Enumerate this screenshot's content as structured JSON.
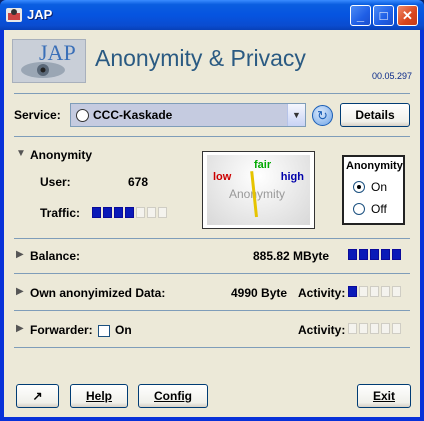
{
  "window": {
    "title": "JAP",
    "minimize": "_",
    "maximize": "□",
    "close": "✕"
  },
  "header": {
    "logo_text": "JAP",
    "title": "Anonymity & Privacy",
    "version": "00.05.297"
  },
  "service": {
    "label": "Service:",
    "selected": "CCC-Kaskade",
    "details_button": "Details"
  },
  "anonymity": {
    "section_label": "Anonymity",
    "user_label": "User:",
    "user_count": "678",
    "traffic_label": "Traffic:",
    "traffic_level": {
      "filled": 4,
      "total": 7
    },
    "gauge": {
      "low": "low",
      "fair": "fair",
      "high": "high",
      "name": "Anonymity"
    },
    "switch": {
      "title": "Anonymity",
      "on_label": "On",
      "off_label": "Off",
      "selected": "On"
    }
  },
  "balance": {
    "label": "Balance:",
    "value": "885.82 MByte",
    "level": {
      "filled": 5,
      "total": 5
    }
  },
  "own_data": {
    "label": "Own anonyimized Data:",
    "value": "4990 Byte",
    "activity_label": "Activity:",
    "activity": {
      "filled": 1,
      "total": 5
    }
  },
  "forwarder": {
    "label": "Forwarder:",
    "checkbox_label": "On",
    "checked": false,
    "activity_label": "Activity:",
    "activity": {
      "filled": 0,
      "total": 5
    }
  },
  "footer": {
    "pin_icon": "↗",
    "help": "Help",
    "config": "Config",
    "exit": "Exit"
  }
}
